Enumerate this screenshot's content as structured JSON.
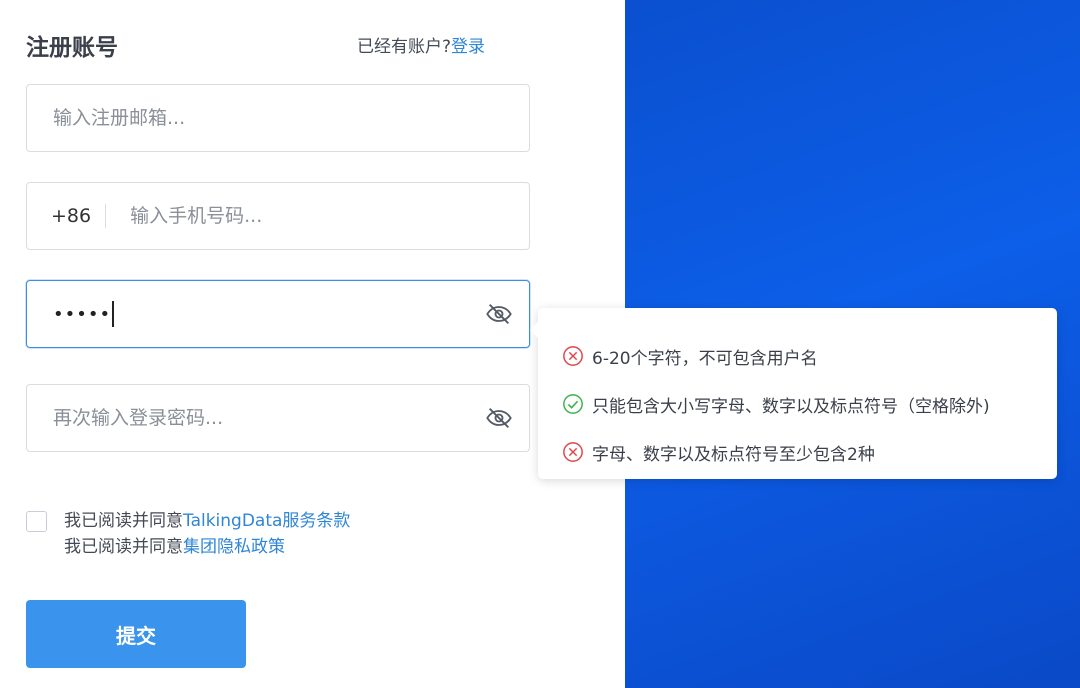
{
  "form": {
    "title": "注册账号",
    "login_prompt": "已经有账户?",
    "login_link": "登录",
    "email_placeholder": "输入注册邮箱...",
    "phone_prefix": "+86",
    "phone_placeholder": "输入手机号码...",
    "password_value": "•••••",
    "confirm_placeholder": "再次输入登录密码...",
    "agreements": [
      {
        "text": "我已阅读并同意",
        "link": "TalkingData服务条款"
      },
      {
        "text": "我已阅读并同意",
        "link": "集团隐私政策"
      }
    ],
    "submit_label": "提交"
  },
  "password_rules": [
    {
      "text": "6-20个字符，不可包含用户名",
      "status": "fail"
    },
    {
      "text": "只能包含大小写字母、数字以及标点符号（空格除外)",
      "status": "pass"
    },
    {
      "text": "字母、数字以及标点符号至少包含2种",
      "status": "fail"
    }
  ],
  "colors": {
    "accent": "#3a93ec",
    "link": "#2f86d6",
    "panel": "#0d5ee8",
    "fail": "#e0454a",
    "pass": "#3bb34a"
  }
}
